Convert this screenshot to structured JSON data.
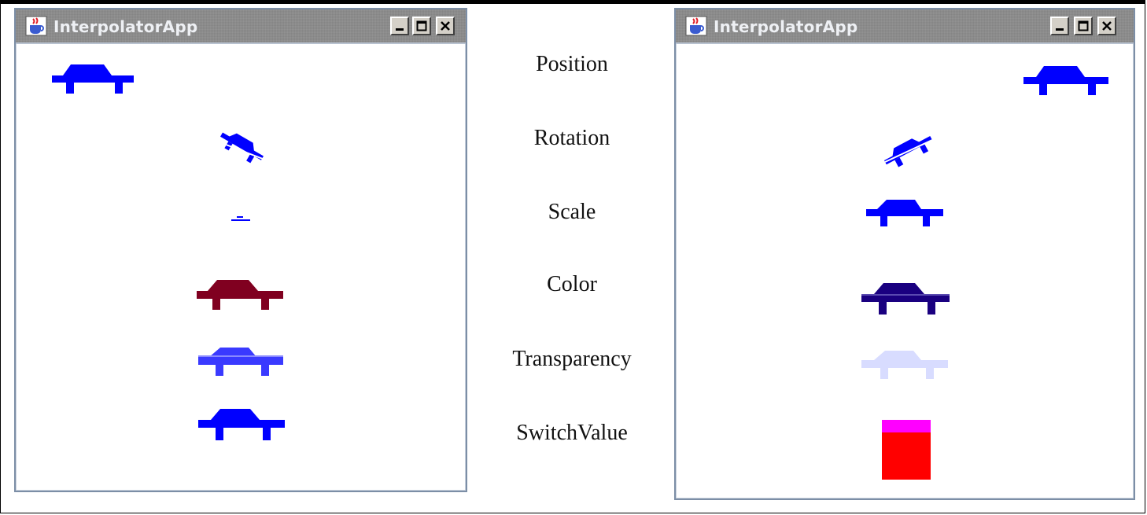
{
  "windows": [
    {
      "title": "InterpolatorApp",
      "icon": "java-cup-icon",
      "controls": [
        "minimize-icon",
        "maximize-icon",
        "close-icon"
      ]
    },
    {
      "title": "InterpolatorApp",
      "icon": "java-cup-icon",
      "controls": [
        "minimize-icon",
        "maximize-icon",
        "close-icon"
      ]
    }
  ],
  "labels": [
    "Position",
    "Rotation",
    "Scale",
    "Color",
    "Transparency",
    "SwitchValue"
  ],
  "colors": {
    "car_blue": "#0000ff",
    "car_maroon": "#800020",
    "car_lightblue": "#3a3aff",
    "car_navy": "#1a0080",
    "car_pale": "#d8dcff",
    "switch_magenta": "#ff00ff",
    "switch_red": "#ff0000",
    "window_border": "#7c8ea6"
  }
}
